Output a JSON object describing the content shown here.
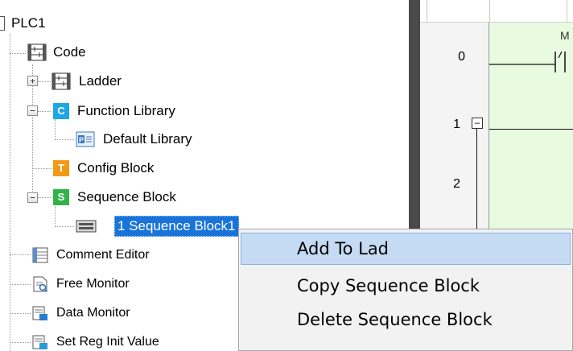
{
  "tree": {
    "root_label": "PLC1",
    "items": [
      {
        "label": "Code"
      },
      {
        "label": "Ladder"
      },
      {
        "label": "Function Library"
      },
      {
        "label": "Default Library"
      },
      {
        "label": "Config Block",
        "icon_letter": "T",
        "icon_color": "#f29a18"
      },
      {
        "label": "Sequence Block",
        "icon_letter": "S",
        "icon_color": "#33b24a"
      },
      {
        "label": "1 Sequence Block1"
      },
      {
        "label": "Comment Editor"
      },
      {
        "label": "Free Monitor"
      },
      {
        "label": "Data Monitor"
      },
      {
        "label": "Set Reg Init Value"
      }
    ],
    "function_library_icon_letter": "C",
    "function_library_icon_color": "#1ea7e4",
    "selection_color": "#1a73d9"
  },
  "ladder": {
    "rungs": [
      "0",
      "1",
      "2"
    ],
    "contact_label": "M",
    "rung_bg": "#e8fbe0"
  },
  "context_menu": {
    "items": [
      {
        "label": "Add To Lad"
      },
      {
        "label": "Copy Sequence Block"
      },
      {
        "label": "Delete Sequence Block"
      }
    ],
    "hover_color": "#c5dbf3"
  }
}
